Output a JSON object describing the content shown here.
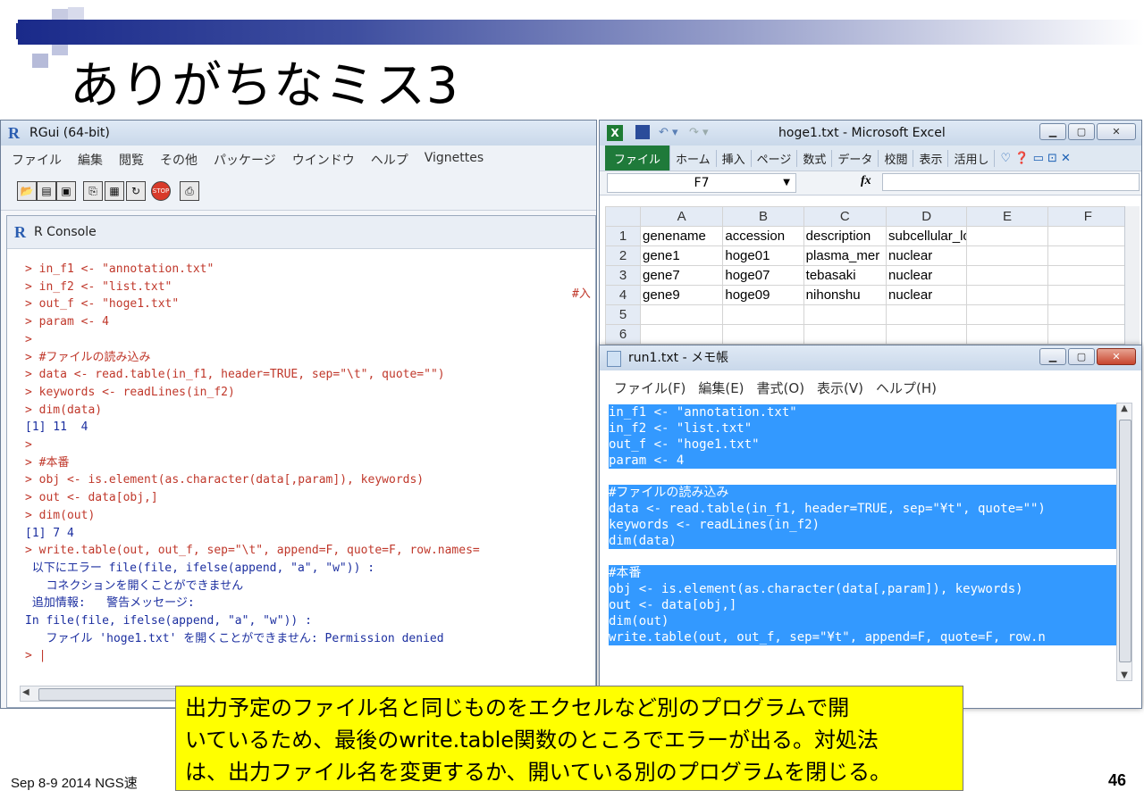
{
  "slide": {
    "title": "ありがちなミス3",
    "footer_left": "Sep 8-9 2014 NGS速",
    "page_number": "46",
    "note_lines": [
      "出力予定のファイル名と同じものをエクセルなど別のプログラムで開",
      "いているため、最後のwrite.table関数のところでエラーが出る。対処法",
      "は、出力ファイル名を変更するか、開いている別のプログラムを閉じる。"
    ]
  },
  "rgui": {
    "window_title": "RGui (64-bit)",
    "menu": [
      "ファイル",
      "編集",
      "閲覧",
      "その他",
      "パッケージ",
      "ウインドウ",
      "ヘルプ",
      "Vignettes"
    ],
    "console_title": "R Console",
    "console_side_text": "#入",
    "console_lines": [
      {
        "text": "> in_f1 <- \"annotation.txt\"",
        "kind": "in"
      },
      {
        "text": "> in_f2 <- \"list.txt\"",
        "kind": "in"
      },
      {
        "text": "> out_f <- \"hoge1.txt\"",
        "kind": "in"
      },
      {
        "text": "> param <- 4",
        "kind": "in"
      },
      {
        "text": ">",
        "kind": "in"
      },
      {
        "text": "> #ファイルの読み込み",
        "kind": "in"
      },
      {
        "text": "> data <- read.table(in_f1, header=TRUE, sep=\"\\t\", quote=\"\")",
        "kind": "in"
      },
      {
        "text": "> keywords <- readLines(in_f2)",
        "kind": "in"
      },
      {
        "text": "> dim(data)",
        "kind": "in"
      },
      {
        "text": "[1] 11  4",
        "kind": "out"
      },
      {
        "text": ">",
        "kind": "in"
      },
      {
        "text": "> #本番",
        "kind": "in"
      },
      {
        "text": "> obj <- is.element(as.character(data[,param]), keywords)",
        "kind": "in"
      },
      {
        "text": "> out <- data[obj,]",
        "kind": "in"
      },
      {
        "text": "> dim(out)",
        "kind": "in"
      },
      {
        "text": "[1] 7 4",
        "kind": "out"
      },
      {
        "text": "> write.table(out, out_f, sep=\"\\t\", append=F, quote=F, row.names=",
        "kind": "in"
      },
      {
        "text": " 以下にエラー file(file, ifelse(append, \"a\", \"w\")) :",
        "kind": "out"
      },
      {
        "text": "   コネクションを開くことができません",
        "kind": "out"
      },
      {
        "text": " 追加情報:   警告メッセージ:",
        "kind": "out"
      },
      {
        "text": "In file(file, ifelse(append, \"a\", \"w\")) :",
        "kind": "out"
      },
      {
        "text": "   ファイル 'hoge1.txt' を開くことができません: Permission denied",
        "kind": "out"
      },
      {
        "text": "> |",
        "kind": "in"
      }
    ]
  },
  "excel": {
    "window_title": "hoge1.txt  -  Microsoft Excel",
    "ribbon_tabs": [
      "ファイル",
      "ホーム",
      "挿入",
      "ページ",
      "数式",
      "データ",
      "校閲",
      "表示",
      "活用し"
    ],
    "name_box": "F7",
    "fx_label": "fx",
    "columns": [
      "A",
      "B",
      "C",
      "D",
      "E",
      "F"
    ],
    "rows": [
      {
        "n": "1",
        "cells": [
          "genename",
          "accession",
          "description",
          "subcellular_location",
          "",
          ""
        ]
      },
      {
        "n": "2",
        "cells": [
          "gene1",
          "hoge01",
          "plasma_mer",
          "nuclear",
          "",
          ""
        ]
      },
      {
        "n": "3",
        "cells": [
          "gene7",
          "hoge07",
          "tebasaki",
          "nuclear",
          "",
          ""
        ]
      },
      {
        "n": "4",
        "cells": [
          "gene9",
          "hoge09",
          "nihonshu",
          "nuclear",
          "",
          ""
        ]
      },
      {
        "n": "5",
        "cells": [
          "",
          "",
          "",
          "",
          "",
          ""
        ]
      },
      {
        "n": "6",
        "cells": [
          "",
          "",
          "",
          "",
          "",
          ""
        ]
      }
    ]
  },
  "notepad": {
    "window_title": "run1.txt - メモ帳",
    "menu": [
      "ファイル(F)",
      "編集(E)",
      "書式(O)",
      "表示(V)",
      "ヘルプ(H)"
    ],
    "lines": [
      "in_f1 <- \"annotation.txt\"",
      "in_f2 <- \"list.txt\"",
      "out_f <- \"hoge1.txt\"",
      "param <- 4",
      "",
      "#ファイルの読み込み",
      "data <- read.table(in_f1, header=TRUE, sep=\"¥t\", quote=\"\")",
      "keywords <- readLines(in_f2)",
      "dim(data)",
      "",
      "#本番",
      "obj <- is.element(as.character(data[,param]), keywords)",
      "out <- data[obj,]",
      "dim(out)",
      "write.table(out, out_f, sep=\"¥t\", append=F, quote=F, row.n"
    ]
  }
}
